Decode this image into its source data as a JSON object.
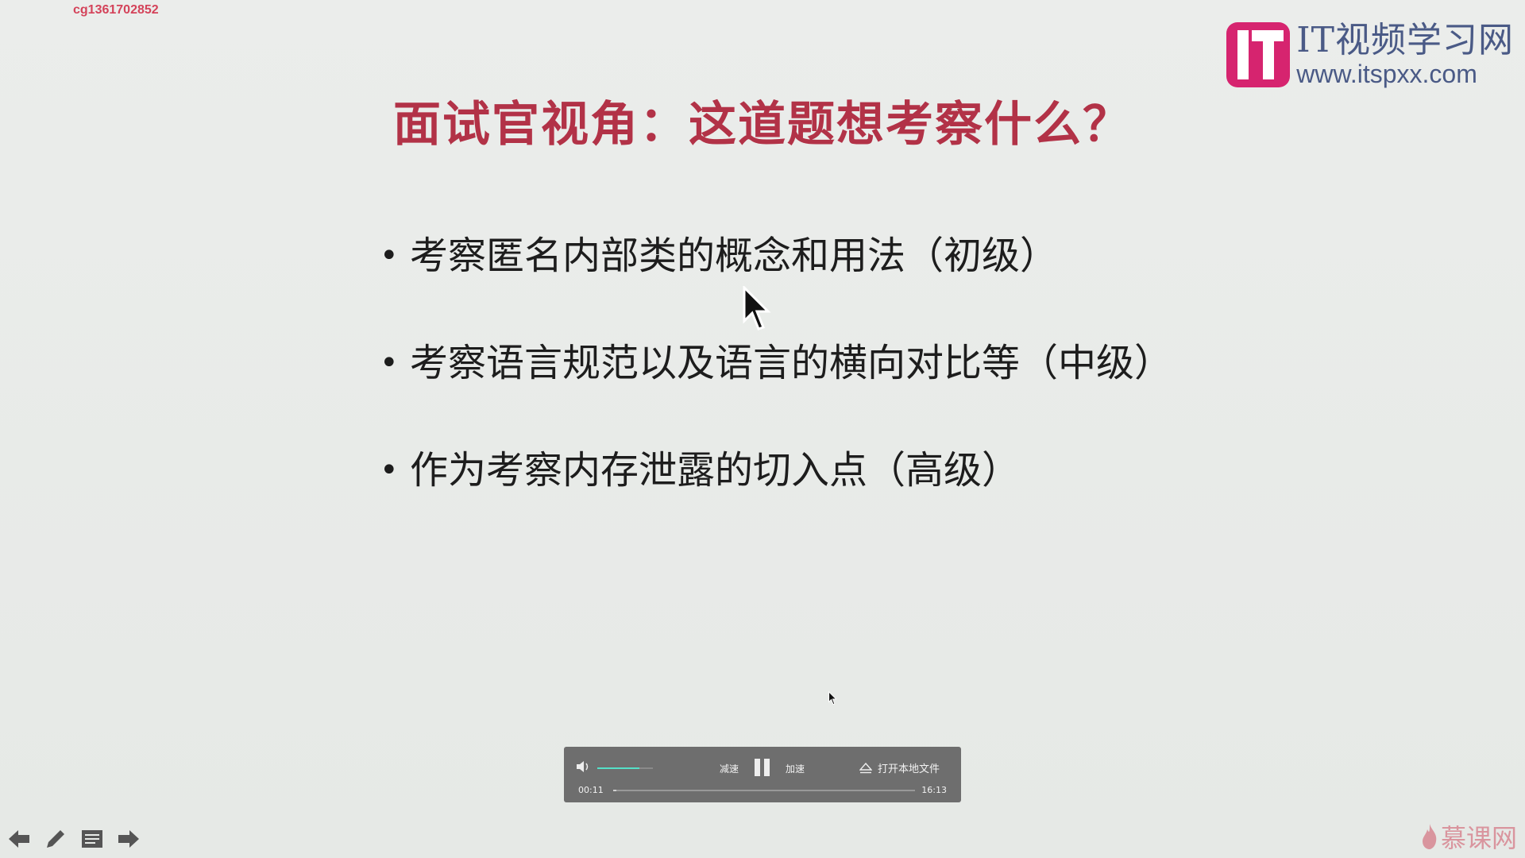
{
  "user_id": "cg1361702852",
  "watermark": {
    "cn": "IT视频学习网",
    "url": "www.itspxx.com"
  },
  "slide": {
    "title": "面试官视角：这道题想考察什么？",
    "bullets": [
      "考察匿名内部类的概念和用法（初级）",
      "考察语言规范以及语言的横向对比等（中级）",
      "作为考察内存泄露的切入点（高级）"
    ],
    "bullet_glyph": "•"
  },
  "player": {
    "slow_label": "减速",
    "fast_label": "加速",
    "open_label": "打开本地文件",
    "current_time": "00:11",
    "total_time": "16:13",
    "volume_level": 0.75,
    "progress": 0.011,
    "accent_color": "#55e0c8"
  },
  "nav": {
    "icons": [
      "arrow-left-icon",
      "pen-icon",
      "notes-icon",
      "arrow-right-icon"
    ]
  },
  "brand": {
    "label": "慕课网",
    "color": "#d9959e"
  }
}
